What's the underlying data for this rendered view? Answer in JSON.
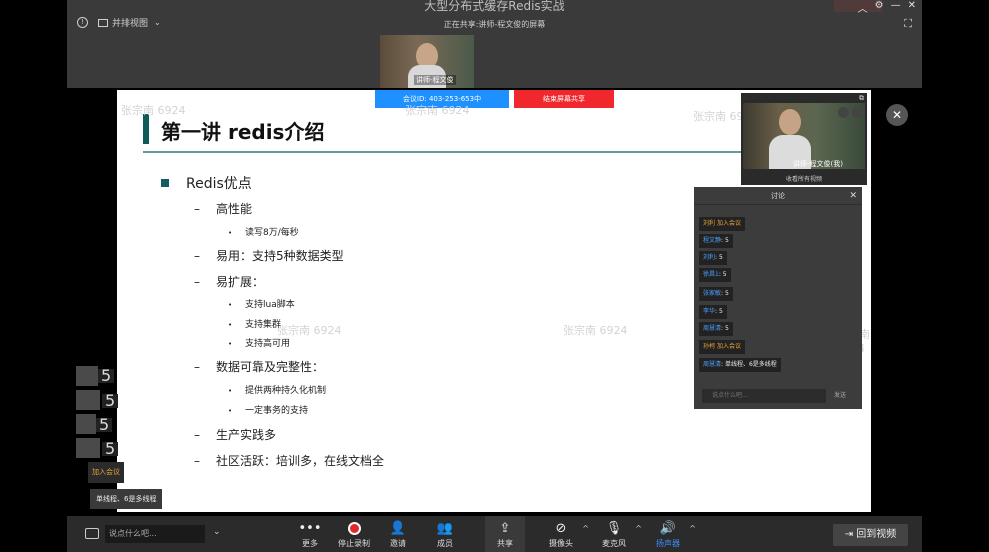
{
  "window": {
    "title": "大型分布式缓存Redis实战",
    "layout_label": "并排视图",
    "sharing_status": "正在共享:讲师-程文俊的屏幕",
    "controls": [
      "︿",
      "⚙",
      "—",
      "✕"
    ]
  },
  "presenter_video": {
    "name": "讲师-程文俊"
  },
  "share_banner": {
    "meeting_id": "会议ID: 403-253-653中",
    "end_share": "结束屏幕共享"
  },
  "slide": {
    "title": "第一讲 redis介绍",
    "watermark": "张宗南 6924",
    "heading": "Redis优点",
    "items": {
      "i1": "高性能",
      "i1a": "读写8万/每秒",
      "i2": "易用：支持5种数据类型",
      "i3": "易扩展：",
      "i3a": "支持lua脚本",
      "i3b": "支持集群",
      "i3c": "支持高可用",
      "i4": "数据可靠及完整性：",
      "i4a": "提供两种持久化机制",
      "i4b": "一定事务的支持",
      "i5": "生产实践多",
      "i6": "社区活跃：培训多，在线文档全"
    }
  },
  "self_video": {
    "name": "讲师-程文俊(我)",
    "caption": "收看所有视频"
  },
  "chat": {
    "title": "讨论",
    "messages": [
      {
        "name": "刘利",
        "text": "加入会议",
        "type": "join"
      },
      {
        "name": "程文静",
        "text": "5",
        "type": "msg"
      },
      {
        "name": "刘利",
        "text": "5",
        "type": "msg"
      },
      {
        "name": "徐昌1",
        "text": "5",
        "type": "msg"
      },
      {
        "name": "张家敏",
        "text": "5",
        "type": "msg"
      },
      {
        "name": "李华",
        "text": "5",
        "type": "msg"
      },
      {
        "name": "周慧清",
        "text": "5",
        "type": "msg"
      },
      {
        "name": "孙柯",
        "text": "加入会议",
        "type": "join"
      },
      {
        "name": "周慧清",
        "text": "单线程、6是多线程",
        "type": "msg"
      }
    ],
    "input_placeholder": "说点什么吧...",
    "send_label": "发送"
  },
  "left_overlay": {
    "v1": "5",
    "v2": "5",
    "v3": "5",
    "v4": "5",
    "join": "加入会议",
    "final": "单线程、6是多线程"
  },
  "toolbar": {
    "input_placeholder": "说点什么吧...",
    "more": "更多",
    "stop_record": "停止录制",
    "invite": "邀请",
    "members": "成员",
    "share": "共享",
    "camera": "摄像头",
    "mic": "麦克风",
    "speaker": "扬声器",
    "return_video": "回到视频"
  }
}
